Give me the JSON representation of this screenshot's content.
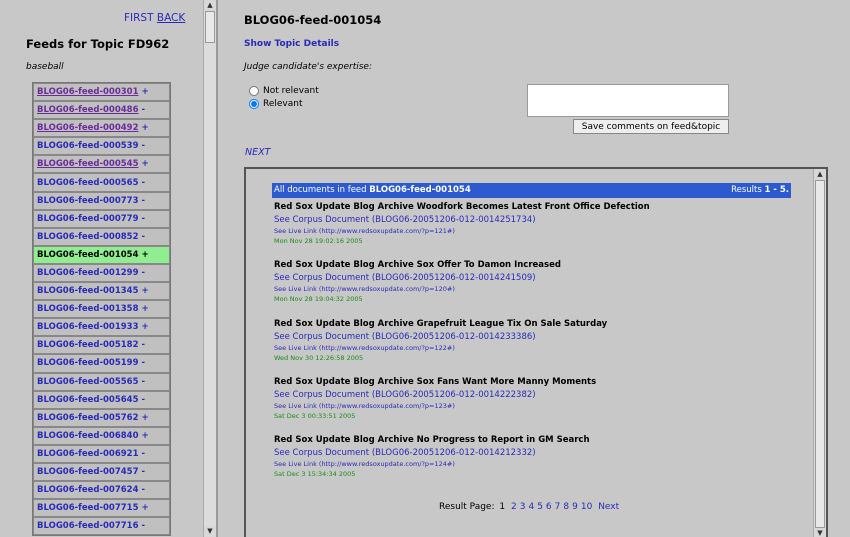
{
  "left": {
    "nav": {
      "first": "FIRST",
      "back": "BACK"
    },
    "title": "Feeds for Topic FD962",
    "topic": "baseball",
    "feeds": [
      {
        "id": "BLOG06-feed-000301",
        "mark": "+"
      },
      {
        "id": "BLOG06-feed-000486",
        "mark": "-"
      },
      {
        "id": "BLOG06-feed-000492",
        "mark": "+"
      },
      {
        "id": "BLOG06-feed-000539",
        "mark": "-"
      },
      {
        "id": "BLOG06-feed-000545",
        "mark": "+"
      },
      {
        "id": "BLOG06-feed-000565",
        "mark": "-"
      },
      {
        "id": "BLOG06-feed-000773",
        "mark": "-"
      },
      {
        "id": "BLOG06-feed-000779",
        "mark": "-"
      },
      {
        "id": "BLOG06-feed-000852",
        "mark": "-"
      },
      {
        "id": "BLOG06-feed-001054",
        "mark": "+"
      },
      {
        "id": "BLOG06-feed-001299",
        "mark": "-"
      },
      {
        "id": "BLOG06-feed-001345",
        "mark": "+"
      },
      {
        "id": "BLOG06-feed-001358",
        "mark": "+"
      },
      {
        "id": "BLOG06-feed-001933",
        "mark": "+"
      },
      {
        "id": "BLOG06-feed-005182",
        "mark": "-"
      },
      {
        "id": "BLOG06-feed-005199",
        "mark": "-"
      },
      {
        "id": "BLOG06-feed-005565",
        "mark": "-"
      },
      {
        "id": "BLOG06-feed-005645",
        "mark": "-"
      },
      {
        "id": "BLOG06-feed-005762",
        "mark": "+"
      },
      {
        "id": "BLOG06-feed-006840",
        "mark": "+"
      },
      {
        "id": "BLOG06-feed-006921",
        "mark": "-"
      },
      {
        "id": "BLOG06-feed-007457",
        "mark": "-"
      },
      {
        "id": "BLOG06-feed-007624",
        "mark": "-"
      },
      {
        "id": "BLOG06-feed-007715",
        "mark": "+"
      },
      {
        "id": "BLOG06-feed-007716",
        "mark": "-"
      }
    ]
  },
  "main": {
    "feed_title": "BLOG06-feed-001054",
    "show_topic": "Show Topic Details",
    "judge_label": "Judge candidate's expertise:",
    "radio_not": "Not relevant",
    "radio_rel": "Relevant",
    "save_button": "Save comments on feed&topic",
    "next": "NEXT"
  },
  "docs": {
    "header_prefix": "All documents in feed",
    "header_feed": "BLOG06-feed-001054",
    "results_prefix": "Results",
    "results_range": "1 - 5.",
    "items": [
      {
        "title": "Red Sox Update Blog Archive Woodfork Becomes Latest Front Office Defection",
        "corpus": "See Corpus Document (BLOG06-20051206-012-0014251734)",
        "live": "See Live Link (http://www.redsoxupdate.com/?p=121#)",
        "date": "Mon Nov 28 19:02:16 2005"
      },
      {
        "title": "Red Sox Update Blog Archive Sox Offer To Damon Increased",
        "corpus": "See Corpus Document (BLOG06-20051206-012-0014241509)",
        "live": "See Live Link (http://www.redsoxupdate.com/?p=120#)",
        "date": "Mon Nov 28 19:04:32 2005"
      },
      {
        "title": "Red Sox Update Blog Archive Grapefruit League Tix On Sale Saturday",
        "corpus": "See Corpus Document (BLOG06-20051206-012-0014233386)",
        "live": "See Live Link (http://www.redsoxupdate.com/?p=122#)",
        "date": "Wed Nov 30 12:26:58 2005"
      },
      {
        "title": "Red Sox Update Blog Archive Sox Fans Want More Manny Moments",
        "corpus": "See Corpus Document (BLOG06-20051206-012-0014222382)",
        "live": "See Live Link (http://www.redsoxupdate.com/?p=123#)",
        "date": "Sat Dec 3 00:33:51 2005"
      },
      {
        "title": "Red Sox Update Blog Archive No Progress to Report in GM Search",
        "corpus": "See Corpus Document (BLOG06-20051206-012-0014212332)",
        "live": "See Live Link (http://www.redsoxupdate.com/?p=124#)",
        "date": "Sat Dec 3 15:34:34 2005"
      }
    ],
    "pager": {
      "label": "Result Page:",
      "current": "1",
      "pages": [
        "2",
        "3",
        "4",
        "5",
        "6",
        "7",
        "8",
        "9",
        "10"
      ],
      "next": "Next"
    }
  }
}
